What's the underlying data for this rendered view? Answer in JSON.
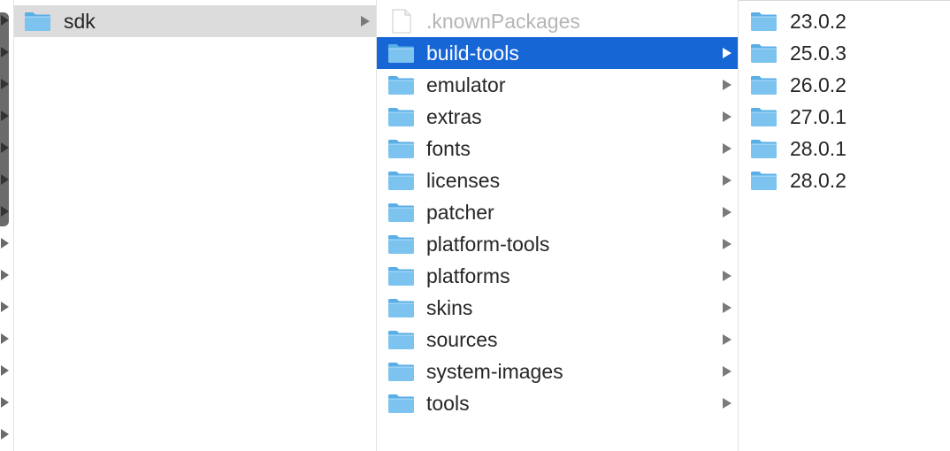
{
  "column1": {
    "items": [
      {
        "label": "sdk",
        "has_children": true,
        "selected": true
      }
    ]
  },
  "column2": {
    "items": [
      {
        "label": ".knownPackages",
        "type": "file",
        "has_children": false
      },
      {
        "label": "build-tools",
        "type": "folder",
        "has_children": true,
        "selected": true
      },
      {
        "label": "emulator",
        "type": "folder",
        "has_children": true
      },
      {
        "label": "extras",
        "type": "folder",
        "has_children": true
      },
      {
        "label": "fonts",
        "type": "folder",
        "has_children": true
      },
      {
        "label": "licenses",
        "type": "folder",
        "has_children": true
      },
      {
        "label": "patcher",
        "type": "folder",
        "has_children": true
      },
      {
        "label": "platform-tools",
        "type": "folder",
        "has_children": true
      },
      {
        "label": "platforms",
        "type": "folder",
        "has_children": true
      },
      {
        "label": "skins",
        "type": "folder",
        "has_children": true
      },
      {
        "label": "sources",
        "type": "folder",
        "has_children": true
      },
      {
        "label": "system-images",
        "type": "folder",
        "has_children": true
      },
      {
        "label": "tools",
        "type": "folder",
        "has_children": true
      }
    ]
  },
  "column3": {
    "items": [
      {
        "label": "23.0.2",
        "type": "folder"
      },
      {
        "label": "25.0.3",
        "type": "folder"
      },
      {
        "label": "26.0.2",
        "type": "folder"
      },
      {
        "label": "27.0.1",
        "type": "folder"
      },
      {
        "label": "28.0.1",
        "type": "folder"
      },
      {
        "label": "28.0.2",
        "type": "folder"
      }
    ]
  },
  "colors": {
    "selection_active": "#1766d6",
    "selection_inactive": "#dcdcdc",
    "folder_body": "#7cc3f0",
    "folder_tab": "#5aaee6"
  }
}
